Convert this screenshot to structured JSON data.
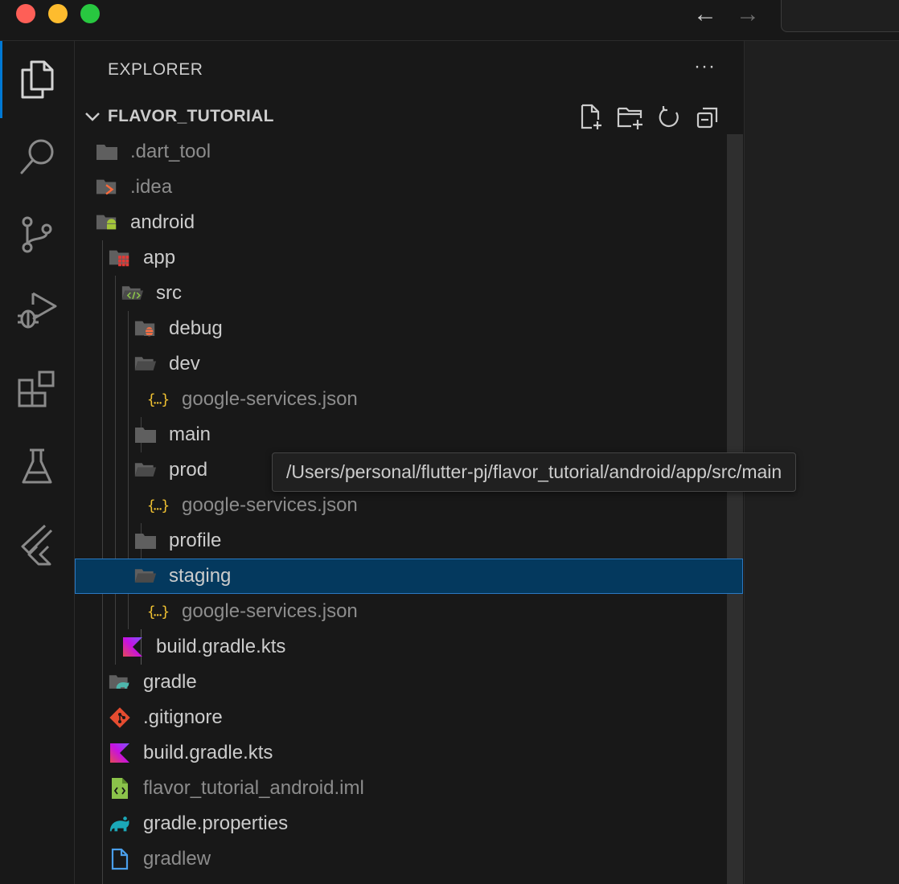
{
  "window": {
    "traffic_lights": [
      "close",
      "minimize",
      "zoom"
    ],
    "nav": {
      "back_icon": "arrow-left-icon",
      "forward_icon": "arrow-right-icon",
      "back_glyph": "←",
      "forward_glyph": "→"
    }
  },
  "activity_bar": {
    "items": [
      {
        "name": "explorer",
        "icon": "files-icon",
        "active": true
      },
      {
        "name": "search",
        "icon": "search-icon"
      },
      {
        "name": "source-control",
        "icon": "source-control-icon"
      },
      {
        "name": "run-and-debug",
        "icon": "run-debug-icon"
      },
      {
        "name": "extensions",
        "icon": "extensions-icon"
      },
      {
        "name": "testing",
        "icon": "flask-icon"
      },
      {
        "name": "flutter",
        "icon": "flutter-icon"
      }
    ],
    "accent": "#0078d4"
  },
  "explorer": {
    "title": "EXPLORER",
    "more": "···",
    "section_title": "FLAVOR_TUTORIAL",
    "actions": [
      "new-file-icon",
      "new-folder-icon",
      "refresh-icon",
      "collapse-all-icon"
    ],
    "tree": [
      {
        "label": ".dart_tool",
        "icon": "folder-icon",
        "dim": true
      },
      {
        "label": ".idea",
        "icon": "idea-folder-icon",
        "dim": true
      },
      {
        "label": "android",
        "icon": "android-folder-icon"
      },
      {
        "label": "app",
        "icon": "app-folder-icon"
      },
      {
        "label": "src",
        "icon": "src-folder-icon"
      },
      {
        "label": "debug",
        "icon": "debug-folder-icon"
      },
      {
        "label": "dev",
        "icon": "folder-open-icon"
      },
      {
        "label": "google-services.json",
        "icon": "json-icon",
        "dim": true
      },
      {
        "label": "main",
        "icon": "folder-icon"
      },
      {
        "label": "prod",
        "icon": "folder-open-icon"
      },
      {
        "label": "google-services.json",
        "icon": "json-icon",
        "dim": true
      },
      {
        "label": "profile",
        "icon": "folder-icon"
      },
      {
        "label": "staging",
        "icon": "folder-open-icon",
        "selected": true
      },
      {
        "label": "google-services.json",
        "icon": "json-icon",
        "dim": true
      },
      {
        "label": "build.gradle.kts",
        "icon": "kotlin-icon"
      },
      {
        "label": "gradle",
        "icon": "gradle-folder-icon"
      },
      {
        "label": ".gitignore",
        "icon": "git-icon"
      },
      {
        "label": "build.gradle.kts",
        "icon": "kotlin-icon"
      },
      {
        "label": "flavor_tutorial_android.iml",
        "icon": "iml-icon",
        "dim": true
      },
      {
        "label": "gradle.properties",
        "icon": "gradle-icon"
      },
      {
        "label": "gradlew",
        "icon": "file-icon",
        "dim": true
      }
    ],
    "tooltip": "/Users/personal/flutter-pj/flavor_tutorial/android/app/src/main"
  },
  "colors": {
    "selection_bg": "#04395e",
    "selection_border": "#2b79c2",
    "json": "#f1c232",
    "kotlin": "#7f52ff",
    "git": "#e44c30",
    "gradle": "#1ba8b8",
    "android": "#a4c639",
    "iml": "#8bc34a"
  }
}
